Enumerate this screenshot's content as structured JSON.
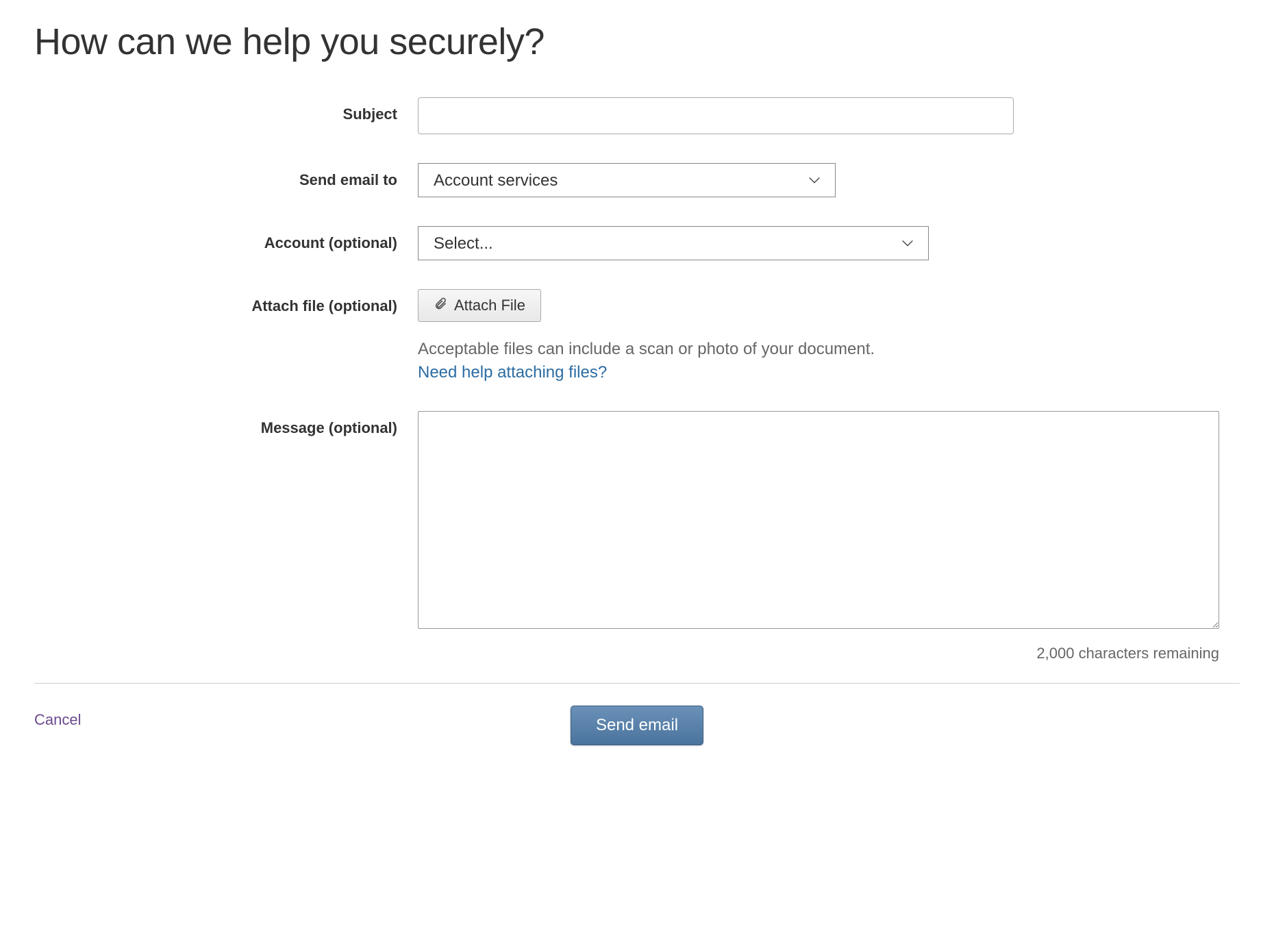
{
  "page": {
    "title": "How can we help you securely?"
  },
  "form": {
    "subject": {
      "label": "Subject",
      "value": ""
    },
    "send_to": {
      "label": "Send email to",
      "selected": "Account services"
    },
    "account": {
      "label": "Account (optional)",
      "selected": "Select..."
    },
    "attach": {
      "label": "Attach file (optional)",
      "button": "Attach File",
      "hint": "Acceptable files can include a scan or photo of your document.",
      "help_link": "Need help attaching files?"
    },
    "message": {
      "label": "Message (optional)",
      "value": "",
      "counter": "2,000 characters remaining"
    }
  },
  "actions": {
    "cancel": "Cancel",
    "send": "Send email"
  }
}
